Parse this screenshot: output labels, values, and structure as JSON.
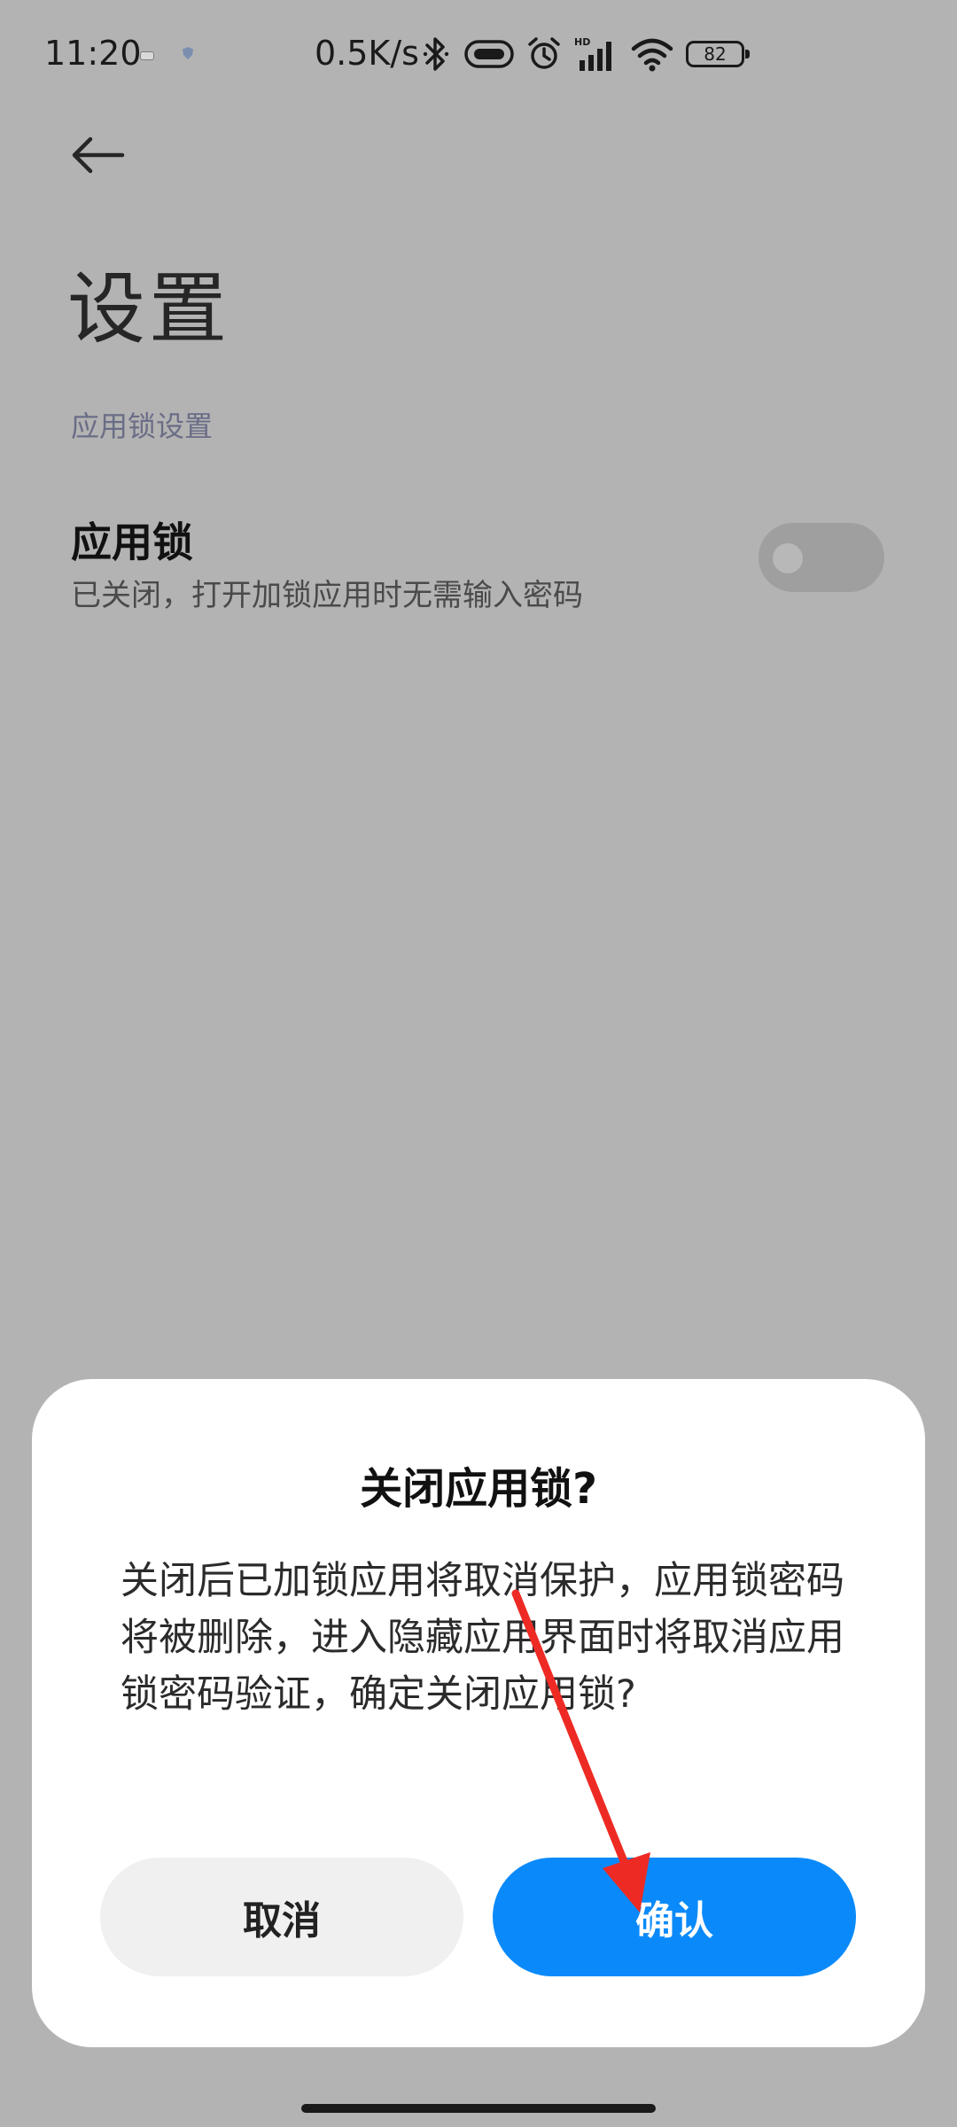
{
  "status_bar": {
    "time": "11:20",
    "net_speed": "0.5K/s",
    "battery_level": "82",
    "signal_label": "HD"
  },
  "header": {
    "title": "设置"
  },
  "section": {
    "header": "应用锁设置"
  },
  "app_lock_setting": {
    "title": "应用锁",
    "subtitle": "已关闭，打开加锁应用时无需输入密码",
    "enabled": false
  },
  "dialog": {
    "title": "关闭应用锁?",
    "message": "关闭后已加锁应用将取消保护，应用锁密码将被删除，进入隐藏应用界面时将取消应用锁密码验证，确定关闭应用锁?",
    "cancel_label": "取消",
    "confirm_label": "确认"
  },
  "colors": {
    "scrim": "#b3b3b3",
    "accent": "#0a8afa",
    "annotation_arrow": "#ee2a24"
  }
}
